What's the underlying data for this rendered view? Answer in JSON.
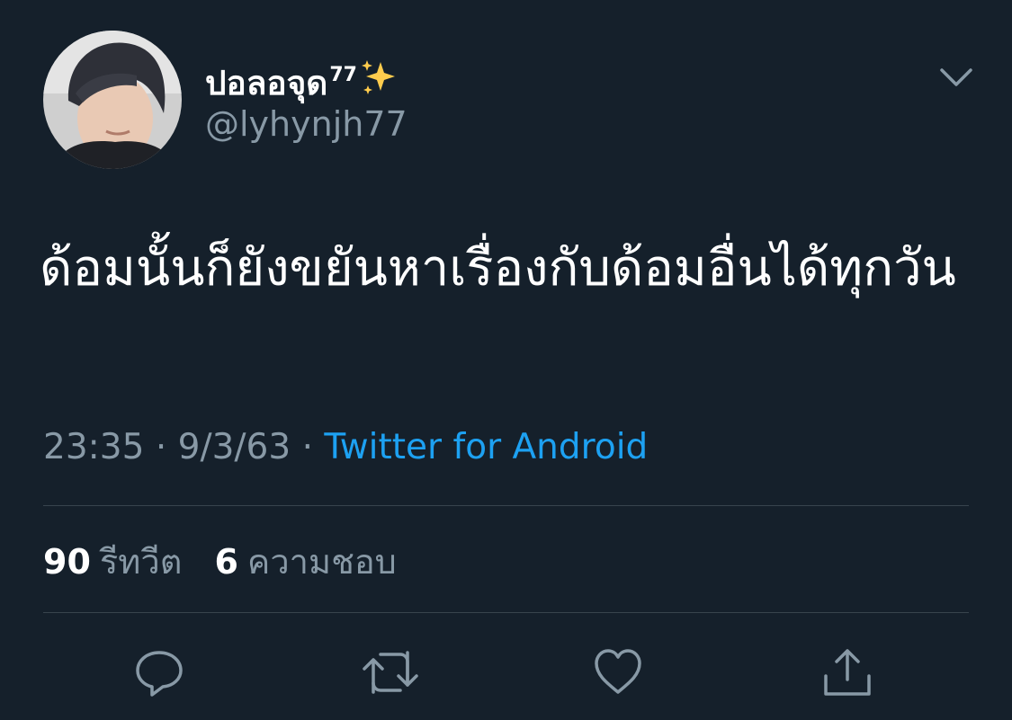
{
  "tweet": {
    "author": {
      "display_name": "ปอลอจุด",
      "name_superscript": "77",
      "name_emoji": "sparkles-emoji",
      "handle": "@lyhynjh77"
    },
    "text": "ด้อมนั้นก็ยังขยันหาเรื่องกับด้อมอื่นได้ทุกวัน",
    "time": "23:35",
    "date": "9/3/63",
    "separator": "·",
    "source": "Twitter for Android",
    "stats": {
      "retweets_count": "90",
      "retweets_label": "รีทวีต",
      "likes_count": "6",
      "likes_label": "ความชอบ"
    }
  },
  "icons": {
    "menu": "chevron-down-icon",
    "reply": "reply-icon",
    "retweet": "retweet-icon",
    "like": "heart-icon",
    "share": "share-icon"
  },
  "colors": {
    "background": "#15202b",
    "text_primary": "#ffffff",
    "text_secondary": "#8899a6",
    "link": "#1da1f2",
    "divider": "#38444d",
    "sparkle": "#ffcc4d"
  }
}
